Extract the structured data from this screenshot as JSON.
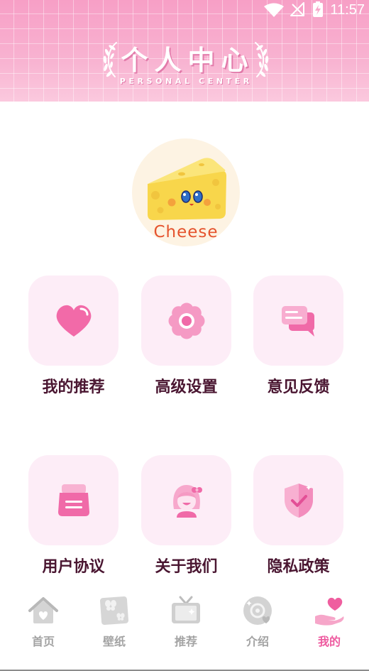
{
  "status_bar": {
    "time": "11:57",
    "icons": [
      "wifi-icon",
      "no-signal-icon",
      "battery-charging-icon"
    ]
  },
  "header": {
    "title": "个人中心",
    "subtitle": "PERSONAL CENTER",
    "decoration": "laurel-icon"
  },
  "avatar": {
    "label": "Cheese",
    "icon": "cheese-avatar-icon"
  },
  "menu": {
    "items": [
      {
        "label": "我的推荐",
        "icon": "heart-icon"
      },
      {
        "label": "高级设置",
        "icon": "flower-icon"
      },
      {
        "label": "意见反馈",
        "icon": "chat-bubbles-icon"
      },
      {
        "label": "用户协议",
        "icon": "jar-document-icon"
      },
      {
        "label": "关于我们",
        "icon": "girl-avatar-icon"
      },
      {
        "label": "隐私政策",
        "icon": "shield-check-icon"
      }
    ]
  },
  "tabbar": {
    "items": [
      {
        "label": "首页",
        "icon": "house-icon",
        "active": false
      },
      {
        "label": "壁纸",
        "icon": "wallpaper-icon",
        "active": false
      },
      {
        "label": "推荐",
        "icon": "tv-icon",
        "active": false
      },
      {
        "label": "介绍",
        "icon": "disc-icon",
        "active": false
      },
      {
        "label": "我的",
        "icon": "hand-heart-icon",
        "active": true
      }
    ]
  },
  "colors": {
    "accent": "#ee5a9f",
    "header_pink": "#f8b3d1",
    "card_background": "#fdedf7",
    "label_text": "#4a1631",
    "tab_inactive": "#a3a3a3"
  }
}
